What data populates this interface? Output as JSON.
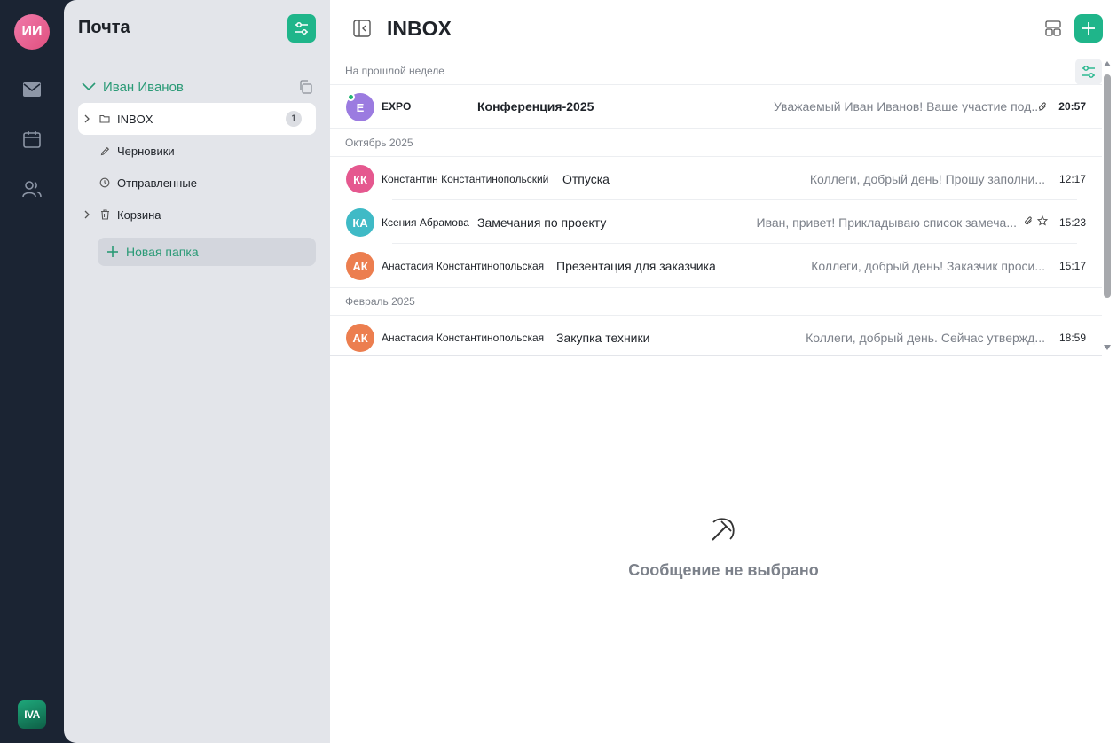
{
  "rail": {
    "user_initials": "ИИ",
    "logo_text": "IVA",
    "icons": [
      "mail-icon",
      "calendar-icon",
      "contacts-icon"
    ]
  },
  "folders_panel": {
    "title": "Почта",
    "account_name": "Иван Иванов",
    "items": [
      {
        "label": "INBOX",
        "icon": "folder-icon",
        "count": "1",
        "active": true
      },
      {
        "label": "Черновики",
        "icon": "pencil-icon"
      },
      {
        "label": "Отправленные",
        "icon": "clock-icon"
      },
      {
        "label": "Корзина",
        "icon": "trash-icon"
      }
    ],
    "new_folder_label": "Новая папка"
  },
  "main": {
    "title": "INBOX",
    "groups": [
      {
        "label": "На прошлой неделе"
      },
      {
        "label": "Октябрь 2025"
      },
      {
        "label": "Февраль 2025"
      }
    ],
    "messages": [
      {
        "initials": "E",
        "sender": "EXPO",
        "subject": "Конференция-2025",
        "preview": "Уважаемый Иван Иванов! Ваше участие под...",
        "time": "20:57",
        "unread": true,
        "online": true,
        "attachment": true,
        "avatar_color": "#9b7be0"
      },
      {
        "initials": "КК",
        "sender": "Константин Константинопольский",
        "subject": "Отпуска",
        "preview": "Коллеги, добрый день! Прошу заполни...",
        "time": "12:17",
        "avatar_color": "#e5588f"
      },
      {
        "initials": "КА",
        "sender": "Ксения Абрамова",
        "subject": "Замечания по проекту",
        "preview": "Иван, привет! Прикладываю список замеча...",
        "time": "15:23",
        "attachment": true,
        "star": true,
        "avatar_color": "#3fbac6"
      },
      {
        "initials": "АК",
        "sender": "Анастасия Константинопольская",
        "subject": "Презентация для заказчика",
        "preview": "Коллеги, добрый день! Заказчик проси...",
        "time": "15:17",
        "avatar_color": "#ec7e4f"
      },
      {
        "initials": "АК",
        "sender": "Анастасия Константинопольская",
        "subject": "Закупка техники",
        "preview": "Коллеги, добрый день. Сейчас утвержд...",
        "time": "18:59",
        "avatar_color": "#ec7e4f"
      }
    ],
    "empty_state": "Сообщение не выбрано"
  }
}
